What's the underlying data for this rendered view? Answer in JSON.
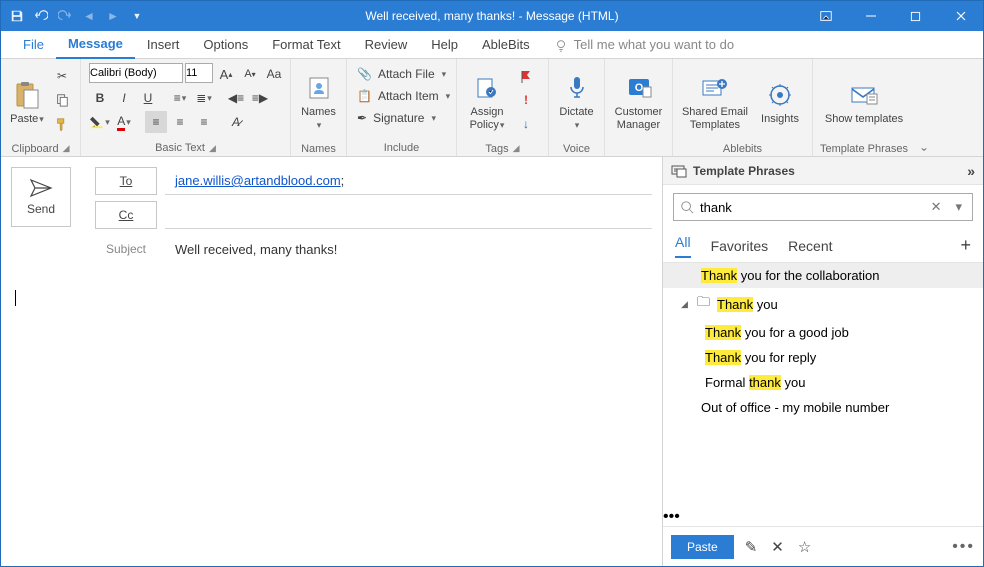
{
  "window": {
    "title": "Well received, many thanks!  -  Message (HTML)"
  },
  "tabs": {
    "file": "File",
    "list": [
      "Message",
      "Insert",
      "Options",
      "Format Text",
      "Review",
      "Help",
      "AbleBits"
    ],
    "active": "Message",
    "tellme": "Tell me what you want to do"
  },
  "ribbon": {
    "clipboard": {
      "label": "Clipboard",
      "paste": "Paste"
    },
    "basic_text": {
      "label": "Basic Text",
      "font_name": "Calibri (Body)",
      "font_size": "11"
    },
    "names": {
      "label": "Names",
      "btn": "Names"
    },
    "include": {
      "label": "Include",
      "attach_file": "Attach File",
      "attach_item": "Attach Item",
      "signature": "Signature"
    },
    "tags": {
      "label": "Tags",
      "assign_policy": "Assign Policy"
    },
    "voice": {
      "label": "Voice",
      "dictate": "Dictate"
    },
    "cm": {
      "label": "",
      "btn": "Customer Manager"
    },
    "ablebits": {
      "label": "Ablebits",
      "shared": "Shared Email Templates",
      "insights": "Insights"
    },
    "tp": {
      "label": "Template Phrases",
      "show": "Show templates"
    }
  },
  "composer": {
    "send": "Send",
    "to_label": "To",
    "cc_label": "Cc",
    "subject_label": "Subject",
    "to_value": "jane.willis@artandblood.com",
    "to_suffix": ";",
    "cc_value": "",
    "subject_value": "Well received, many thanks!"
  },
  "panel": {
    "title": "Template Phrases",
    "search_value": "thank",
    "tabs": {
      "all": "All",
      "fav": "Favorites",
      "recent": "Recent",
      "active": "All",
      "plus": "+"
    },
    "items": [
      {
        "text_pre": "",
        "hl": "Thank",
        "text_post": " you for the collaboration",
        "selected": true,
        "level": 0
      },
      {
        "text_pre": "",
        "hl": "Thank",
        "text_post": " you",
        "selected": false,
        "level": 0,
        "folder": true,
        "expanded": true
      },
      {
        "text_pre": "",
        "hl": "Thank",
        "text_post": " you for a good job",
        "selected": false,
        "level": 1
      },
      {
        "text_pre": "",
        "hl": "Thank",
        "text_post": " you for reply",
        "selected": false,
        "level": 1
      },
      {
        "text_pre": "Formal ",
        "hl": "thank",
        "text_post": " you",
        "selected": false,
        "level": 1
      },
      {
        "text_pre": "Out of office - my mobile number",
        "hl": "",
        "text_post": "",
        "selected": false,
        "level": 0
      }
    ],
    "paste": "Paste"
  }
}
